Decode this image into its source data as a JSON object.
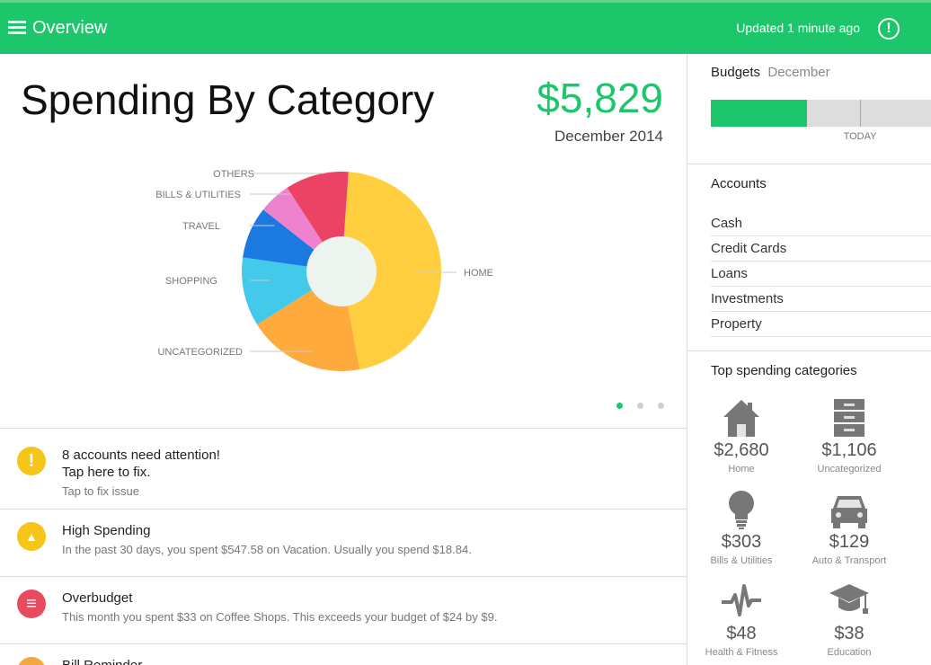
{
  "topbar": {
    "title": "Overview",
    "updated": "Updated 1 minute ago",
    "alert_icon": "!"
  },
  "chart": {
    "title": "Spending By Category",
    "total": "$5,829",
    "period": "December 2014"
  },
  "chart_data": {
    "type": "pie",
    "donut": true,
    "slices": [
      {
        "label": "HOME",
        "value": 2680,
        "color": "#ffcf3f"
      },
      {
        "label": "UNCATEGORIZED",
        "value": 1106,
        "color": "#ffaa3c"
      },
      {
        "label": "SHOPPING",
        "value": 652,
        "color": "#43c9ea"
      },
      {
        "label": "TRAVEL",
        "value": 489,
        "color": "#1b79df"
      },
      {
        "label": "BILLS & UTILITIES",
        "value": 303,
        "color": "#ee82cf"
      },
      {
        "label": "OTHERS",
        "value": 599,
        "color": "#ec4263"
      }
    ]
  },
  "pager": {
    "count": 3,
    "active": 0
  },
  "alerts": [
    {
      "icon": "warning-icon",
      "color": "#f5c518",
      "symbol": "!",
      "title": "8 accounts need attention!",
      "title2": "Tap here to fix.",
      "subtitle": "Tap to fix issue"
    },
    {
      "icon": "high-spending-icon",
      "color": "#f5c518",
      "symbol": "▲",
      "title": "High Spending",
      "subtitle": "In the past 30 days, you spent $547.58 on Vacation.  Usually you spend $18.84."
    },
    {
      "icon": "overbudget-icon",
      "color": "#e84a5f",
      "symbol": "≡",
      "title": "Overbudget",
      "subtitle": "This month you spent $33 on Coffee Shops. This exceeds your budget of $24 by $9."
    },
    {
      "icon": "bill-reminder-icon",
      "color": "#f5a742",
      "symbol": "",
      "title": "Bill Reminder",
      "subtitle": ""
    }
  ],
  "budgets": {
    "title": "Budgets",
    "month": "December",
    "spent_fraction": 0.435,
    "today_fraction": 0.675,
    "today_label": "TODAY"
  },
  "accounts": {
    "title": "Accounts",
    "items": [
      "Cash",
      "Credit Cards",
      "Loans",
      "Investments",
      "Property"
    ]
  },
  "top_categories": {
    "title": "Top spending categories",
    "items": [
      {
        "icon": "home-icon",
        "amount": "$2,680",
        "label": "Home"
      },
      {
        "icon": "cabinet-icon",
        "amount": "$1,106",
        "label": "Uncategorized"
      },
      {
        "icon": "lightbulb-icon",
        "amount": "$303",
        "label": "Bills & Utilities"
      },
      {
        "icon": "car-icon",
        "amount": "$129",
        "label": "Auto & Transport"
      },
      {
        "icon": "heartbeat-icon",
        "amount": "$48",
        "label": "Health & Fitness"
      },
      {
        "icon": "graduation-cap-icon",
        "amount": "$38",
        "label": "Education"
      }
    ]
  }
}
